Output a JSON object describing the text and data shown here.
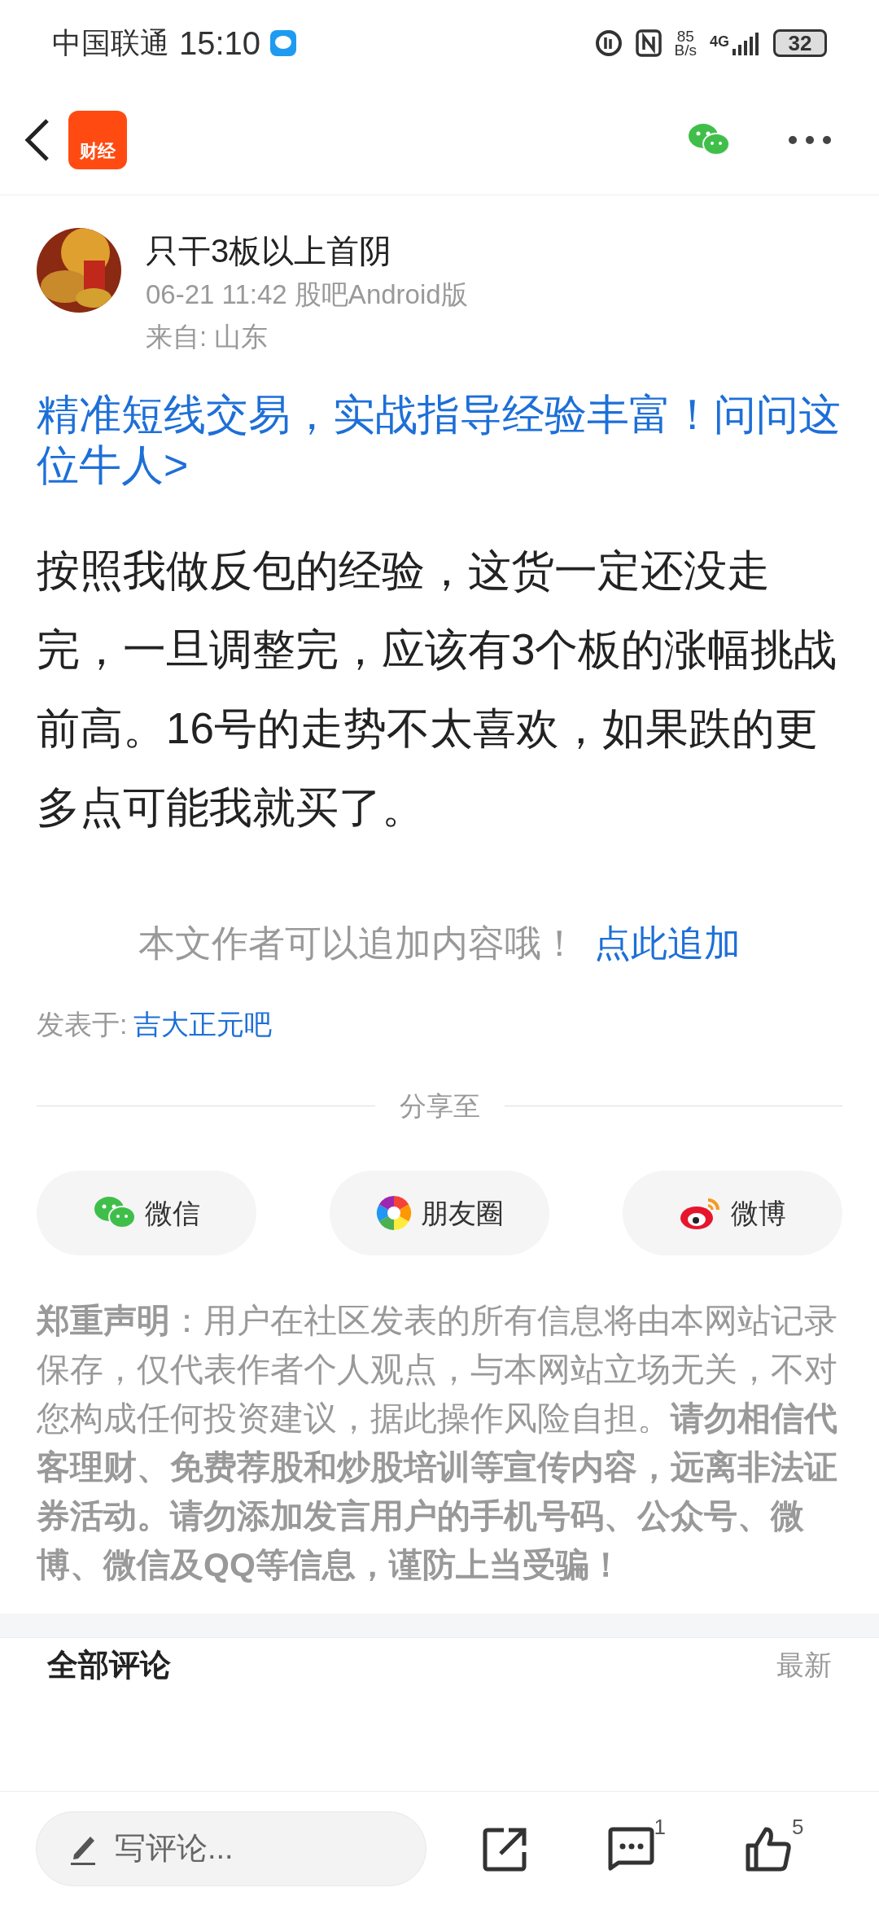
{
  "status_bar": {
    "carrier": "中国联通",
    "time": "15:10",
    "net_speed_value": "85",
    "net_speed_unit": "B/s",
    "network": "4G",
    "battery": "32"
  },
  "header": {
    "logo_text": "财经"
  },
  "author": {
    "name": "只干3板以上首阴",
    "meta": "06-21 11:42 股吧Android版",
    "location": "来自: 山东"
  },
  "promo_link": "精准短线交易，实战指导经验丰富！问问这位牛人>",
  "body": "按照我做反包的经验，这货一定还没走完，一旦调整完，应该有3个板的涨幅挑战前高。16号的走势不太喜欢，如果跌的更多点可能我就买了。",
  "append": {
    "text": "本文作者可以追加内容哦！",
    "link": "点此追加"
  },
  "posted_in": {
    "label": "发表于:",
    "forum": "吉大正元吧"
  },
  "share": {
    "title": "分享至",
    "targets": [
      {
        "kind": "wechat",
        "label": "微信"
      },
      {
        "kind": "moments",
        "label": "朋友圈"
      },
      {
        "kind": "weibo",
        "label": "微博"
      }
    ]
  },
  "disclaimer": "**郑重声明**：用户在社区发表的所有信息将由本网站记录保存，仅代表作者个人观点，与本网站立场无关，不对您构成任何投资建议，据此操作风险自担。**请勿相信代客理财、免费荐股和炒股培训等宣传内容，远离非法证券活动。请勿添加发言用户的手机号码、公众号、微博、微信及QQ等信息，谨防上当受骗！**",
  "comments": {
    "title": "全部评论",
    "sort": "最新"
  },
  "bottom_bar": {
    "placeholder": "写评论...",
    "comment_count": "1",
    "like_count": "5"
  }
}
